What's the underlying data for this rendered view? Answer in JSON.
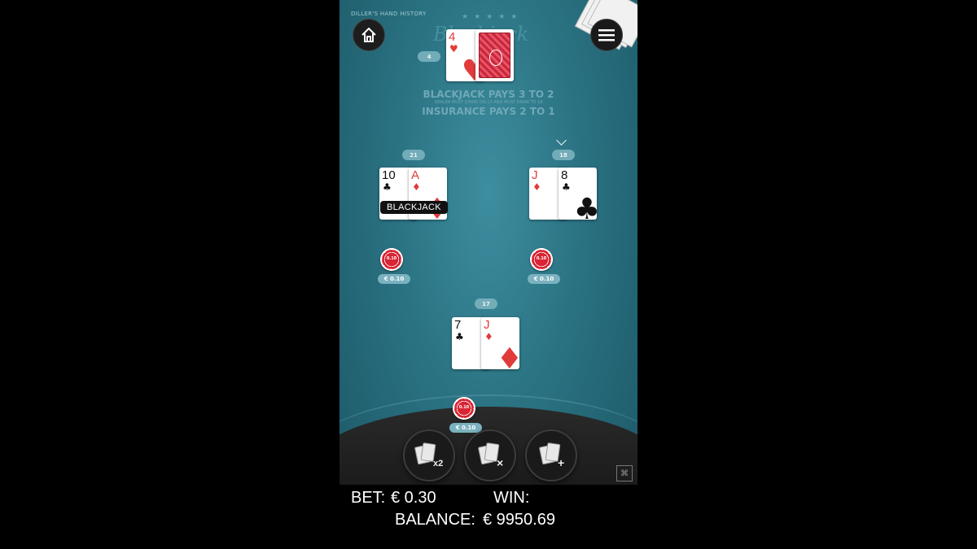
{
  "header": {
    "history_label": "DILLER'S HAND HISTORY",
    "logo_text": "Blackjack",
    "stars": "★★★★★",
    "home_icon": "home-icon",
    "menu_icon": "hamburger-menu-icon"
  },
  "dealer": {
    "count": "4",
    "cards": [
      {
        "rank": "4",
        "suit": "♥",
        "color": "red"
      }
    ],
    "hidden_card": "card-back"
  },
  "rules": {
    "line1": "BLACKJACK PAYS 3 TO 2",
    "line2": "DEALER MUST STAND ON 17 AND MUST DRAW TO 16",
    "line3": "INSURANCE PAYS 2 TO 1"
  },
  "hands": [
    {
      "count": "21",
      "cards": [
        {
          "rank": "10",
          "suit": "♣",
          "color": "black"
        },
        {
          "rank": "A",
          "suit": "♦",
          "color": "red"
        }
      ],
      "badge": "BLACKJACK",
      "chip": "0.10",
      "bet": "€ 0.10"
    },
    {
      "count": "18",
      "active": true,
      "cards": [
        {
          "rank": "J",
          "suit": "♦",
          "color": "red"
        },
        {
          "rank": "8",
          "suit": "♣",
          "color": "black"
        }
      ],
      "chip": "0.10",
      "bet": "€ 0.10"
    },
    {
      "count": "17",
      "cards": [
        {
          "rank": "7",
          "suit": "♣",
          "color": "black"
        },
        {
          "rank": "J",
          "suit": "♦",
          "color": "red"
        }
      ],
      "chip": "0.10",
      "bet": "€ 0.10"
    }
  ],
  "actions": {
    "double": {
      "symbol": "x2",
      "icon": "double-cards-icon"
    },
    "stand": {
      "symbol": "×",
      "icon": "stand-cards-icon"
    },
    "hit": {
      "symbol": "+",
      "icon": "hit-cards-icon"
    }
  },
  "footer": {
    "bet_label": "BET:",
    "bet_value": "€ 0.30",
    "win_label": "WIN:",
    "win_value": "",
    "balance_label": "BALANCE:",
    "balance_value": "€ 9950.69"
  },
  "colors": {
    "felt": "#2a7282",
    "chip": "#d92433",
    "card_red": "#e23b3b"
  }
}
